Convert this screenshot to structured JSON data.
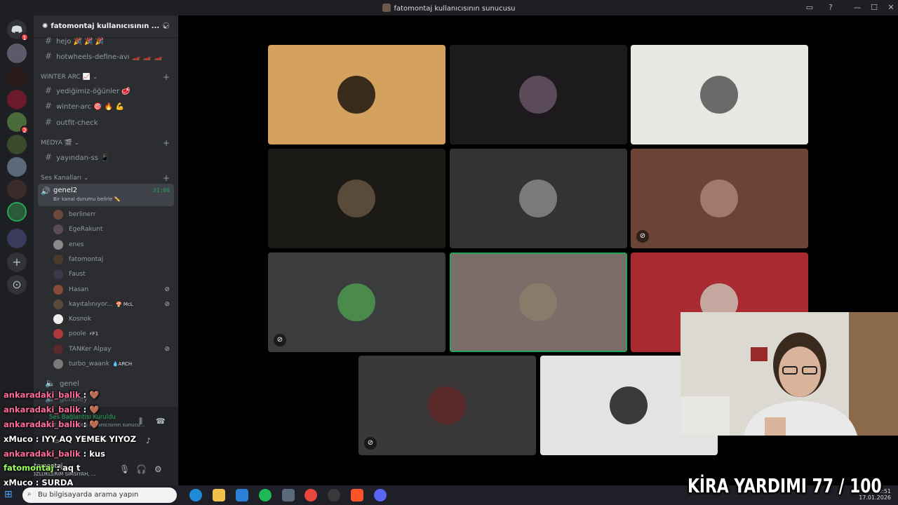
{
  "window": {
    "title": "fatomontaj kullanıcısının sunucusu"
  },
  "rail": {
    "home_badge": "1",
    "badge_2": "2"
  },
  "sidebar": {
    "server_name": "fatomontaj kullanıcısının ...",
    "channels_top": [
      {
        "name": "hejo 🎉 🎉 🎉"
      },
      {
        "name": "hotwheels-define-avı 🏎️ 🏎️ 🏎️"
      }
    ],
    "category_winter": "WINTER ARC 📈",
    "channels_winter": [
      {
        "name": "yediğimiz-öğünler 🥩"
      },
      {
        "name": "winter-arc 🎯 🔥 💪"
      },
      {
        "name": "outfit-check"
      }
    ],
    "category_media": "MEDYA 🎬",
    "channels_media": [
      {
        "name": "yayından-ss 📱"
      }
    ],
    "category_voice": "Ses Kanalları",
    "voice_active": {
      "name": "genel2",
      "time": "31:00",
      "status": "Bir kanal durumu belirle ✏️"
    },
    "voice_users": [
      {
        "name": "berlinerr",
        "badge": "",
        "color": "#6b4a3a"
      },
      {
        "name": "EgeRakunt",
        "badge": "",
        "color": "#5a4a5a"
      },
      {
        "name": "enes",
        "badge": "",
        "color": "#8a8a8a"
      },
      {
        "name": "fatomontaj",
        "badge": "",
        "color": "#4a3a2a"
      },
      {
        "name": "Faust",
        "badge": "",
        "color": "#3a3a4a"
      },
      {
        "name": "Hasan",
        "badge": "",
        "color": "#8a4a3a",
        "muted": true
      },
      {
        "name": "kayıtalınıyor...",
        "badge": "🍄 McL",
        "color": "#5a4a3a",
        "muted": true
      },
      {
        "name": "Kosnok",
        "badge": "",
        "color": "#eeeeee"
      },
      {
        "name": "poole",
        "badge": "⚡F1",
        "color": "#b03a3a"
      },
      {
        "name": "TANKer Alpay",
        "badge": "",
        "color": "#5a2a2a",
        "muted": true
      },
      {
        "name": "turbo_waank",
        "badge": "💧ARCH",
        "color": "#7a7a7a"
      }
    ],
    "voice_other": "genel",
    "voice_other2": "geneley"
  },
  "chat": [
    {
      "user": "ankaradaki_balik",
      "sep": " : ",
      "msg": "🤎",
      "color": "#ff6b9a"
    },
    {
      "user": "ankaradaki_balik",
      "sep": " : ",
      "msg": "🤎",
      "color": "#ff6b9a"
    },
    {
      "user": "ankaradaki_balik",
      "sep": " : ",
      "msg": "🤎",
      "color": "#ff6b9a"
    },
    {
      "user": "xMuco",
      "sep": " : ",
      "msg": "IYY AQ YEMEK YIYOZ",
      "color": "#ffffff"
    },
    {
      "user": "ankaradaki_balik",
      "sep": " : ",
      "msg": "kus",
      "color": "#ff6b9a"
    },
    {
      "user": "fatomontaj",
      "sep": " : ",
      "msg": "aq t",
      "color": "#9cff5c"
    },
    {
      "user": "xMuco",
      "sep": " : ",
      "msg": "ŞURDA",
      "color": "#ffffff"
    }
  ],
  "user_panel": {
    "connection": "Ses Bağlantısı Kuruldu",
    "server_sub": "genel2 / fatomontaj kullanıcısının sunucu...",
    "username": "fatomontaj",
    "activity": "GOZLUKLERIM SIMSIYAH, ..."
  },
  "tiles": [
    {
      "bg": "#d4a15e",
      "avatar": "#3a2a1a",
      "muted": false
    },
    {
      "bg": "#1c1a1d",
      "avatar": "#5a4a5a",
      "muted": false
    },
    {
      "bg": "#e9e7e1",
      "avatar": "#6a6a6a",
      "muted": false
    },
    {
      "bg": "#1c1a17",
      "avatar": "#5a4a3a",
      "muted": false
    },
    {
      "bg": "#333333",
      "avatar": "#7a7a7a",
      "muted": false
    },
    {
      "bg": "#6b4435",
      "avatar": "#a07a6a",
      "muted": true
    },
    {
      "bg": "#3b3c3d",
      "avatar": "#4a8a4a",
      "muted": true
    },
    {
      "bg": "#7b6e69",
      "avatar": "#8a7a6a",
      "muted": false,
      "speaking": true
    },
    {
      "bg": "#a92a30",
      "avatar": "#c4a8a0",
      "muted": false
    },
    {
      "bg": "#3a3738",
      "avatar": "#5a2a2a",
      "muted": true
    },
    {
      "bg": "#e3e3e3",
      "avatar": "#3a3a3a",
      "muted": false
    }
  ],
  "taskbar": {
    "search_placeholder": "Bu bilgisayarda arama yapın",
    "clock_time": "10:51",
    "clock_date": "17.01.2026"
  },
  "overlay": {
    "counter": "KİRA YARDIMI 77 / 100"
  }
}
